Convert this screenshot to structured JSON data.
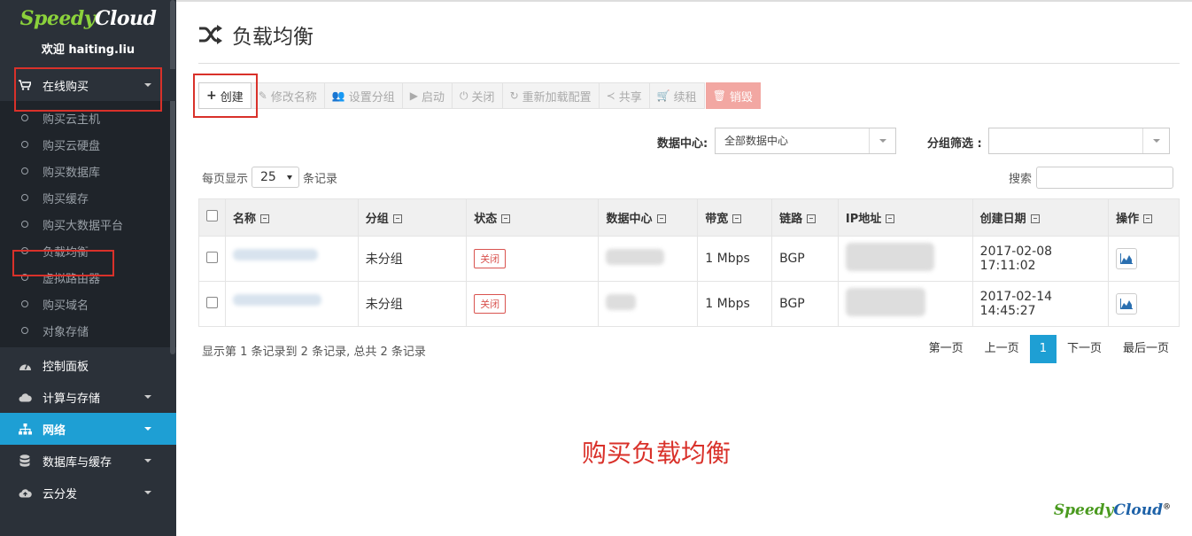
{
  "sidebar": {
    "logo": "SpeedyCloud",
    "welcome": "欢迎 haiting.liu",
    "online_buy": "在线购买",
    "sub_items": [
      "购买云主机",
      "购买云硬盘",
      "购买数据库",
      "购买缓存",
      "购买大数据平台",
      "负载均衡",
      "虚拟路由器",
      "购买域名",
      "对象存储"
    ],
    "control_panel": "控制面板",
    "compute_storage": "计算与存储",
    "network": "网络",
    "db_cache": "数据库与缓存",
    "cdn": "云分发"
  },
  "page": {
    "title": "负载均衡"
  },
  "toolbar": {
    "create": "创建",
    "rename": "修改名称",
    "set_group": "设置分组",
    "start": "启动",
    "stop": "关闭",
    "reload": "重新加载配置",
    "share": "共享",
    "renew": "续租",
    "destroy": "销毁"
  },
  "filters": {
    "datacenter_label": "数据中心:",
    "datacenter_value": "全部数据中心",
    "group_label": "分组筛选 :",
    "group_value": ""
  },
  "list": {
    "per_page_prefix": "每页显示",
    "per_page_value": "25",
    "per_page_suffix": "条记录",
    "search_label": "搜索"
  },
  "table": {
    "headers": [
      "名称",
      "分组",
      "状态",
      "数据中心",
      "带宽",
      "链路",
      "IP地址",
      "创建日期",
      "操作"
    ],
    "rows": [
      {
        "group": "未分组",
        "status": "关闭",
        "bandwidth": "1 Mbps",
        "link": "BGP",
        "created": "2017-02-08 17:11:02"
      },
      {
        "group": "未分组",
        "status": "关闭",
        "bandwidth": "1 Mbps",
        "link": "BGP",
        "created": "2017-02-14 14:45:27"
      }
    ]
  },
  "footer": {
    "info": "显示第 1 条记录到 2 条记录, 总共 2 条记录",
    "first": "第一页",
    "prev": "上一页",
    "current": "1",
    "next": "下一页",
    "last": "最后一页"
  },
  "promo": "购买负载均衡",
  "brand": "SpeedyCloud",
  "colors": {
    "sidebar_bg": "#2b3139",
    "accent": "#1e9fd4",
    "annotation_red": "#d9312a"
  }
}
